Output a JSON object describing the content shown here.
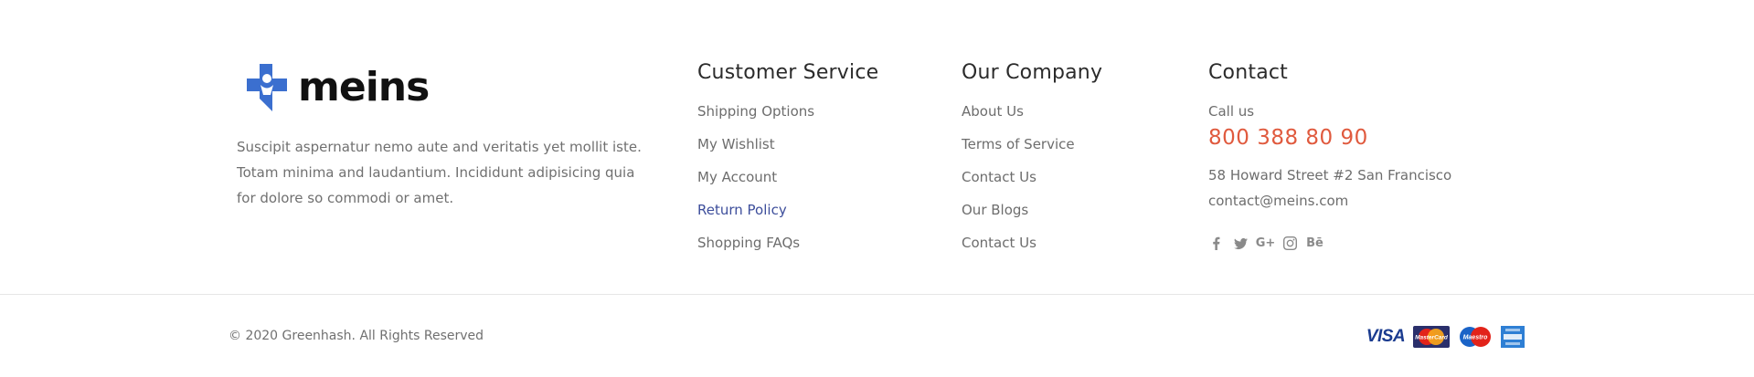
{
  "brand": {
    "logo_text": "meins",
    "description": "Suscipit aspernatur nemo aute and veritatis yet mollit iste. Totam minima and laudantium. Incididunt adipisicing quia for dolore so commodi or amet.",
    "colors": {
      "primary": "#3b6fcf",
      "text": "#111111"
    }
  },
  "customer_service": {
    "title": "Customer Service",
    "items": [
      "Shipping Options",
      "My Wishlist",
      "My Account",
      "Return Policy",
      "Shopping FAQs"
    ],
    "active_index": 3
  },
  "our_company": {
    "title": "Our Company",
    "items": [
      "About Us",
      "Terms of Service",
      "Contact Us",
      "Our Blogs",
      "Contact Us"
    ]
  },
  "contact": {
    "title": "Contact",
    "call_label": "Call us",
    "phone": "800 388 80 90",
    "address": "58 Howard Street #2 San Francisco",
    "email": "contact@meins.com",
    "social": [
      "facebook-icon",
      "twitter-icon",
      "google-plus-icon",
      "instagram-icon",
      "behance-icon"
    ],
    "behance_label": "Bē",
    "google_label": "G+",
    "phone_color": "#e05a3e"
  },
  "bottom": {
    "copyright": "© 2020 Greenhash. All Rights Reserved",
    "payments": [
      "visa-icon",
      "mastercard-icon",
      "maestro-icon",
      "amex-icon"
    ],
    "visa_label": "VISA",
    "mastercard_label": "MasterCard",
    "maestro_label": "Maestro"
  }
}
